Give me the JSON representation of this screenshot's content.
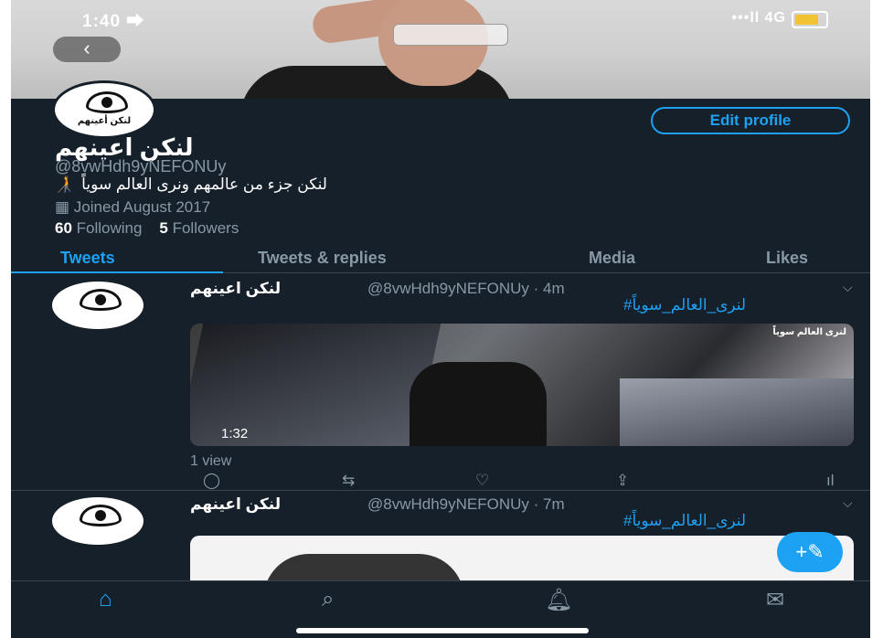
{
  "status_bar": {
    "time": "1:40 ⮕",
    "network": "4G"
  },
  "profile": {
    "avatar_label": "لنكن أعينهم",
    "edit_profile": "Edit profile",
    "name": "لنكن اعينهم",
    "handle": "@8vwHdh9yNEFONUy",
    "bio": "لنكن جزء من عالمهم ونرى العالم سوياً",
    "joined": "Joined August 2017",
    "following_count": "60",
    "following_label": "Following",
    "followers_count": "5",
    "followers_label": "Followers"
  },
  "tabs": [
    "Tweets",
    "Tweets & replies",
    "Media",
    "Likes"
  ],
  "tweets": [
    {
      "name": "لنكن اعينهم",
      "handle_time": "@8vwHdh9yNEFONUy · 4m",
      "text": "#لنرى_العالم_سوياً",
      "video_title": "لنرى العالم سوياً",
      "duration": "1:32",
      "views": "1 view"
    },
    {
      "name": "لنكن اعينهم",
      "handle_time": "@8vwHdh9yNEFONUy · 7m",
      "text": "#لنرى_العالم_سوياً"
    }
  ],
  "icons": {
    "back": "back-chevron-icon",
    "calendar": "calendar-icon",
    "reply": "reply-icon",
    "retweet": "retweet-icon",
    "like": "like-icon",
    "share": "share-icon",
    "analytics": "analytics-icon",
    "compose": "compose-tweet-icon",
    "home": "home-icon",
    "search": "search-icon",
    "notifications": "bell-icon",
    "messages": "mail-icon"
  },
  "colors": {
    "accent": "#1da1f2",
    "background": "#15202b",
    "muted": "#8899a6"
  }
}
